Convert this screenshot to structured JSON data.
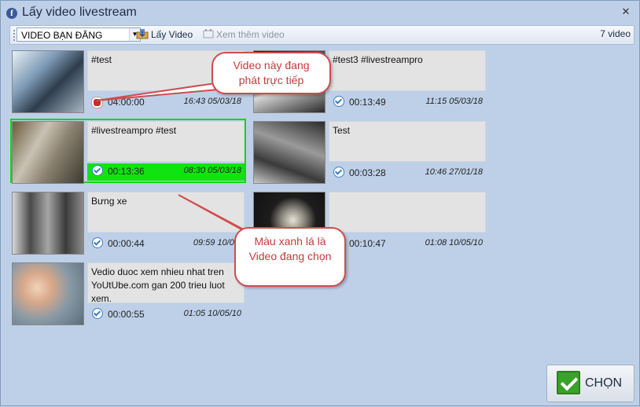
{
  "window": {
    "title": "Lấy video livestream",
    "close": "✕"
  },
  "toolbar": {
    "combo_value": "VIDEO BẠN ĐĂNG",
    "get_video": "Lấy Video",
    "more_video": "Xem thêm video",
    "count": "7 video"
  },
  "videos": [
    {
      "title": "#test",
      "duration": "04:00:00",
      "date": "16:43 05/03/18",
      "status": "live"
    },
    {
      "title": "#test3 #livestreampro",
      "duration": "00:13:49",
      "date": "11:15 05/03/18",
      "status": "done"
    },
    {
      "title": "#livestreampro #test",
      "duration": "00:13:36",
      "date": "08:30 05/03/18",
      "status": "done",
      "selected": true
    },
    {
      "title": "Test",
      "duration": "00:03:28",
      "date": "10:46 27/01/18",
      "status": "done"
    },
    {
      "title": "Bưng xe",
      "duration": "00:00:44",
      "date": "09:59 10/06/",
      "status": "done"
    },
    {
      "title": "",
      "duration": "00:10:47",
      "date": "01:08 10/05/10",
      "status": "done"
    },
    {
      "title": "Vedio duoc xem nhieu nhat tren YoUtUbe.com gan 200 trieu luot xem.",
      "duration": "00:00:55",
      "date": "01:05 10/05/10",
      "status": "done"
    }
  ],
  "callouts": {
    "live": "Video này đang phát trực tiếp",
    "selected": "Màu xanh lá là Video đang chọn"
  },
  "choose_button": "CHỌN",
  "colors": {
    "selected_green": "#10e310",
    "live_red": "#d7242c",
    "callout_border": "#d04c4c"
  }
}
